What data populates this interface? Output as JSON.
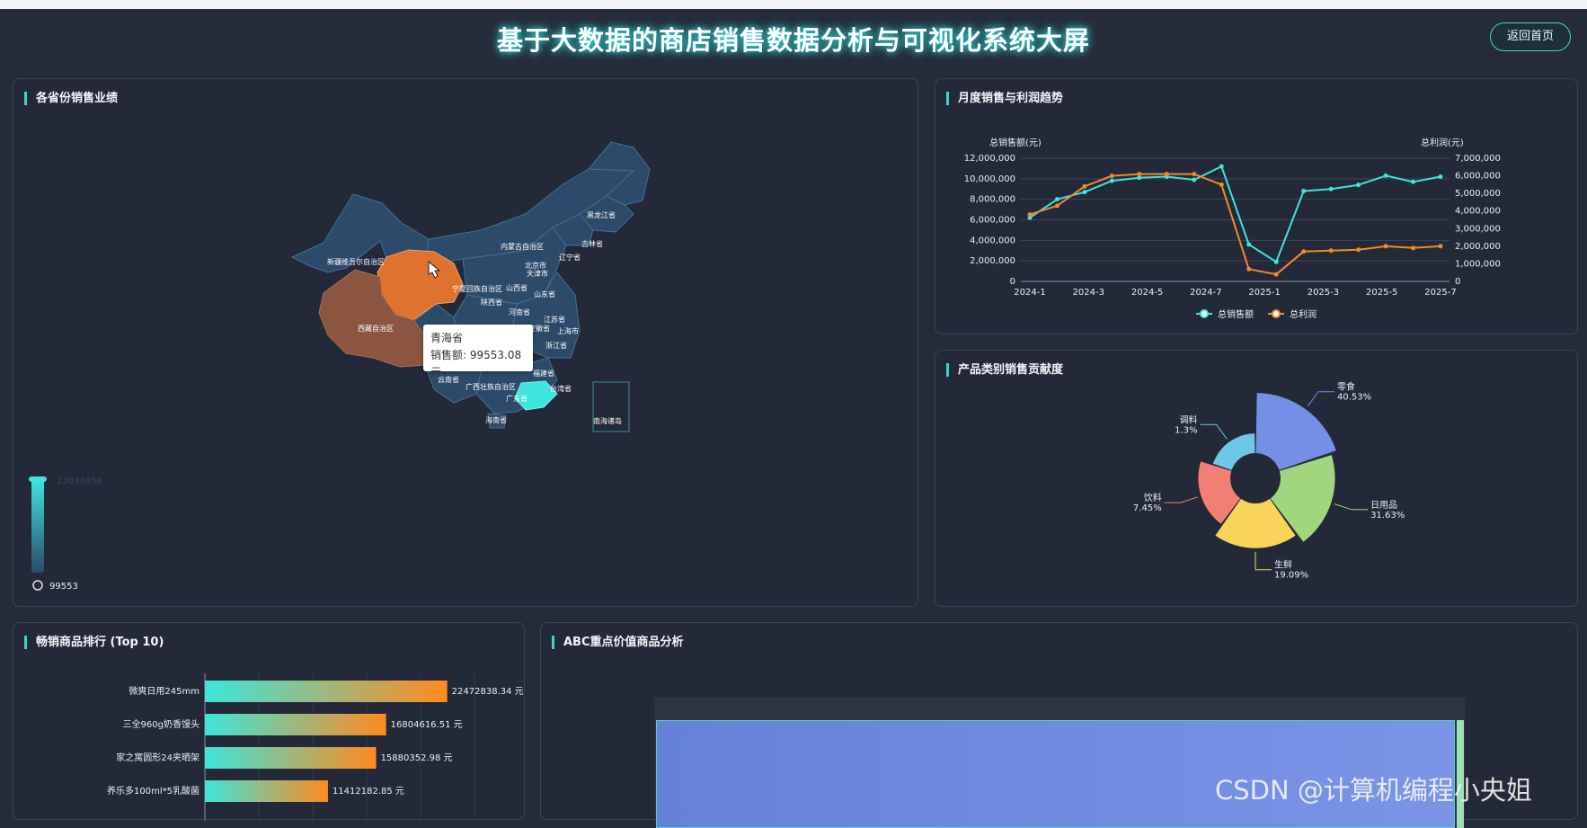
{
  "header": {
    "title": "基于大数据的商店销售数据分析与可视化系统大屏",
    "home_label": "返回首页"
  },
  "map_panel": {
    "title": "各省份销售业绩",
    "tooltip": {
      "province": "青海省",
      "line": "销售额: 99553.08元"
    },
    "visual_map": {
      "max_label": "23034956",
      "min_label": "99553"
    },
    "provinces": [
      "新疆维吾尔自治区",
      "内蒙古自治区",
      "黑龙江省",
      "吉林省",
      "辽宁省",
      "北京市",
      "天津市",
      "山西省",
      "山东省",
      "陕西省",
      "河南省",
      "宁夏回族自治区",
      "江苏省",
      "安徽省",
      "上海市",
      "浙江省",
      "西藏自治区",
      "云南省",
      "广西壮族自治区",
      "广东省",
      "福建省",
      "台湾省",
      "海南省",
      "南海诸岛"
    ],
    "colors": {
      "highlight": "#e0722f",
      "tibet": "#8a5640",
      "low": "#2c4a6a",
      "high": "#3de5dc"
    }
  },
  "trend_panel": {
    "title": "月度销售与利润趋势",
    "chart_data": {
      "type": "line",
      "x": [
        "2024-1",
        "2024-2",
        "2024-3",
        "2024-4",
        "2024-5",
        "2024-6",
        "2024-7",
        "2024-8",
        "2024-9",
        "2024-10",
        "2024-11",
        "2024-12",
        "2025-1",
        "2025-2",
        "2025-3",
        "2025-4",
        "2025-5",
        "2025-6",
        "2025-7",
        "2025-8"
      ],
      "x_tick_labels": [
        "2024-1",
        "2024-3",
        "2024-5",
        "2024-7",
        "2025-1",
        "2025-3",
        "2025-5",
        "2025-7"
      ],
      "y_left_label": "总销售额(元)",
      "y_right_label": "总利润(元)",
      "y_left_ticks": [
        "12,000,000",
        "10,000,000",
        "8,000,000",
        "6,000,000",
        "4,000,000",
        "2,000,000",
        "0"
      ],
      "y_right_ticks": [
        "7,000,000",
        "6,000,000",
        "5,000,000",
        "4,000,000",
        "3,000,000",
        "2,000,000",
        "1,000,000",
        "0"
      ],
      "ylim_left": [
        0,
        12000000
      ],
      "ylim_right": [
        0,
        7000000
      ],
      "series": [
        {
          "name": "总销售额",
          "axis": "left",
          "color": "#3de5dc",
          "values": [
            6200000,
            8000000,
            8700000,
            9800000,
            10100000,
            10200000,
            9900000,
            11200000,
            3600000,
            1900000,
            8800000,
            9000000,
            9400000,
            10300000,
            9700000,
            10200000
          ]
        },
        {
          "name": "总利润",
          "axis": "right",
          "color": "#f08a2a",
          "values": [
            3800000,
            4300000,
            5400000,
            6000000,
            6100000,
            6100000,
            6100000,
            5500000,
            700000,
            400000,
            1700000,
            1750000,
            1800000,
            2000000,
            1900000,
            2000000
          ]
        }
      ]
    }
  },
  "category_panel": {
    "title": "产品类别销售贡献度",
    "chart_data": {
      "type": "pie",
      "variant": "rose-donut",
      "slices": [
        {
          "name": "零食",
          "value": 40.53,
          "label": "40.53%",
          "color": "#7390e6"
        },
        {
          "name": "日用品",
          "value": 31.63,
          "label": "31.63%",
          "color": "#9fd67e"
        },
        {
          "name": "生鲜",
          "value": 19.09,
          "label": "19.09%",
          "color": "#f8d45a"
        },
        {
          "name": "饮料",
          "value": 7.45,
          "label": "7.45%",
          "color": "#f17f73"
        },
        {
          "name": "调料",
          "value": 1.3,
          "label": "1.3%",
          "color": "#6fc6e8"
        }
      ]
    }
  },
  "top10_panel": {
    "title": "畅销商品排行 (Top 10)",
    "chart_data": {
      "type": "bar",
      "orientation": "horizontal",
      "xlim": [
        0,
        25000000
      ],
      "categories": [
        "微爽日用245mm",
        "三全960g奶香馒头",
        "家之寓圆形24夹晒架",
        "养乐多100ml*5乳酸菌"
      ],
      "values": [
        22472838.34,
        16804616.51,
        15880352.98,
        11412182.85
      ],
      "value_labels": [
        "22472838.34 元",
        "16804616.51 元",
        "15880352.98 元",
        "11412182.85 元"
      ],
      "gradient": [
        "#3de5dc",
        "#ff8a1f"
      ]
    }
  },
  "abc_panel": {
    "title": "ABC重点价值商品分析",
    "chart_data": {
      "type": "treemap",
      "blocks": [
        {
          "color": "#6b86de"
        },
        {
          "color": "#9fe0b0"
        }
      ]
    }
  },
  "watermark": "CSDN @计算机编程小央姐"
}
